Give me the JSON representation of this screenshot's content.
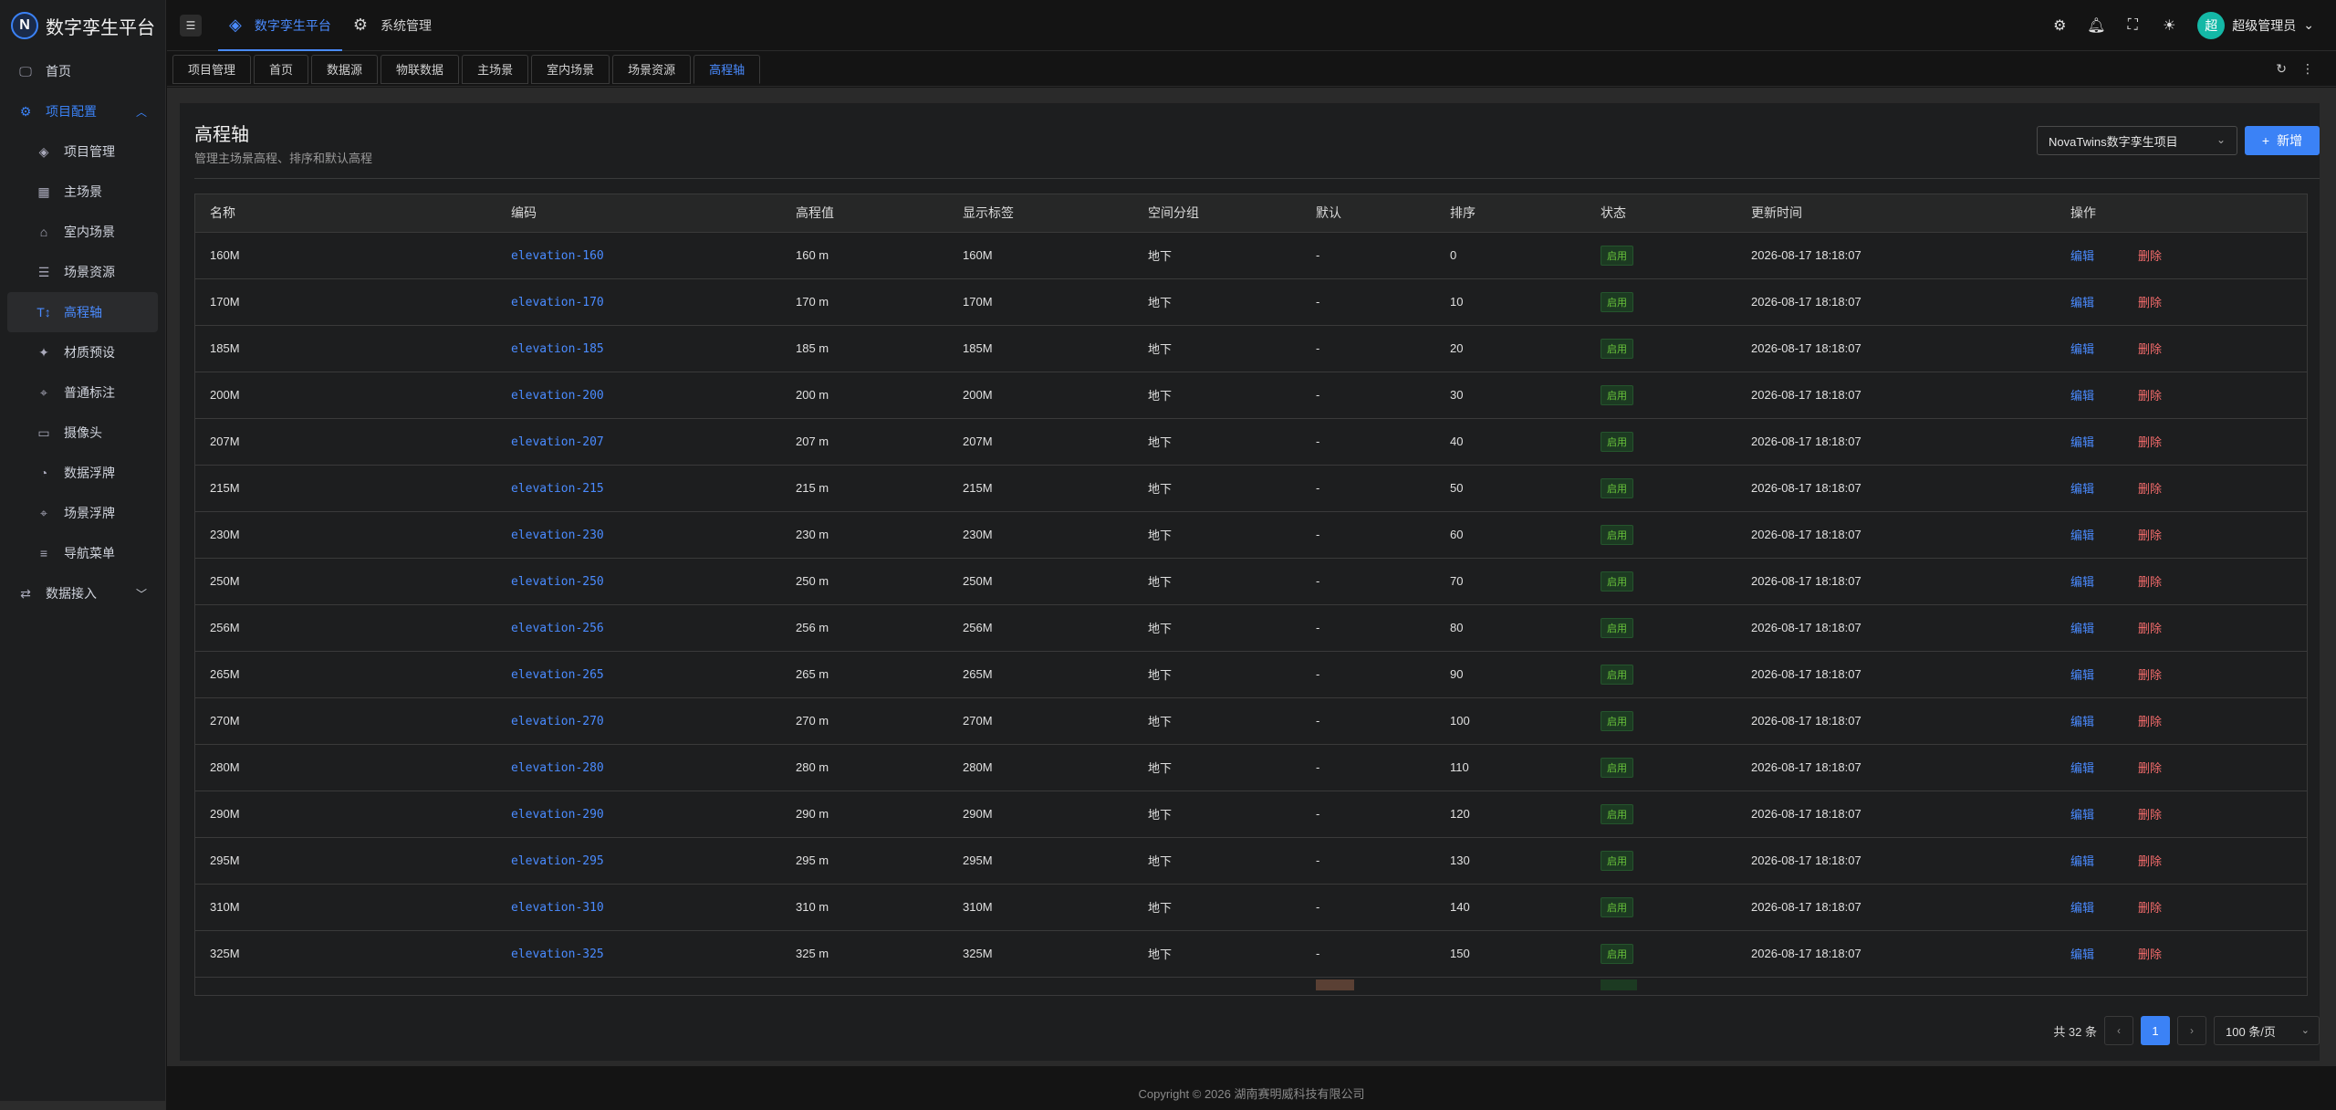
{
  "app": {
    "logo_letter": "N",
    "name": "数字孪生平台"
  },
  "sidebar": {
    "items": [
      {
        "label": "首页",
        "icon": "monitor-icon",
        "type": "top"
      },
      {
        "label": "项目配置",
        "icon": "gear-icon",
        "type": "group"
      },
      {
        "label": "项目管理",
        "icon": "layers-icon",
        "type": "sub"
      },
      {
        "label": "主场景",
        "icon": "grid-icon",
        "type": "sub"
      },
      {
        "label": "室内场景",
        "icon": "home-icon",
        "type": "sub"
      },
      {
        "label": "场景资源",
        "icon": "list-icon",
        "type": "sub"
      },
      {
        "label": "高程轴",
        "icon": "text-height-icon",
        "type": "active"
      },
      {
        "label": "材质预设",
        "icon": "palette-icon",
        "type": "sub"
      },
      {
        "label": "普通标注",
        "icon": "pin-icon",
        "type": "sub"
      },
      {
        "label": "摄像头",
        "icon": "camera-icon",
        "type": "sub"
      },
      {
        "label": "数据浮牌",
        "icon": "gauge-icon",
        "type": "sub"
      },
      {
        "label": "场景浮牌",
        "icon": "location-icon",
        "type": "sub"
      },
      {
        "label": "导航菜单",
        "icon": "menu-icon",
        "type": "sub"
      },
      {
        "label": "数据接入",
        "icon": "swap-icon",
        "type": "top-collapsed"
      }
    ]
  },
  "header": {
    "nav": [
      {
        "label": "数字孪生平台",
        "icon": "layers-icon",
        "active": true
      },
      {
        "label": "系统管理",
        "icon": "gear-icon",
        "active": false
      }
    ],
    "user_avatar": "超",
    "user_name": "超级管理员"
  },
  "tabs": [
    "项目管理",
    "首页",
    "数据源",
    "物联数据",
    "主场景",
    "室内场景",
    "场景资源",
    "高程轴"
  ],
  "active_tab": "高程轴",
  "page": {
    "title": "高程轴",
    "subtitle": "管理主场景高程、排序和默认高程",
    "project_select": "NovaTwins数字孪生项目",
    "add_button": "新增"
  },
  "table": {
    "columns": [
      "名称",
      "编码",
      "高程值",
      "显示标签",
      "空间分组",
      "默认",
      "排序",
      "状态",
      "更新时间",
      "操作"
    ],
    "rows": [
      [
        "160M",
        "elevation-160",
        "160 m",
        "160M",
        "地下",
        "-",
        "0",
        "启用",
        "2026-08-17 18:18:07"
      ],
      [
        "170M",
        "elevation-170",
        "170 m",
        "170M",
        "地下",
        "-",
        "10",
        "启用",
        "2026-08-17 18:18:07"
      ],
      [
        "185M",
        "elevation-185",
        "185 m",
        "185M",
        "地下",
        "-",
        "20",
        "启用",
        "2026-08-17 18:18:07"
      ],
      [
        "200M",
        "elevation-200",
        "200 m",
        "200M",
        "地下",
        "-",
        "30",
        "启用",
        "2026-08-17 18:18:07"
      ],
      [
        "207M",
        "elevation-207",
        "207 m",
        "207M",
        "地下",
        "-",
        "40",
        "启用",
        "2026-08-17 18:18:07"
      ],
      [
        "215M",
        "elevation-215",
        "215 m",
        "215M",
        "地下",
        "-",
        "50",
        "启用",
        "2026-08-17 18:18:07"
      ],
      [
        "230M",
        "elevation-230",
        "230 m",
        "230M",
        "地下",
        "-",
        "60",
        "启用",
        "2026-08-17 18:18:07"
      ],
      [
        "250M",
        "elevation-250",
        "250 m",
        "250M",
        "地下",
        "-",
        "70",
        "启用",
        "2026-08-17 18:18:07"
      ],
      [
        "256M",
        "elevation-256",
        "256 m",
        "256M",
        "地下",
        "-",
        "80",
        "启用",
        "2026-08-17 18:18:07"
      ],
      [
        "265M",
        "elevation-265",
        "265 m",
        "265M",
        "地下",
        "-",
        "90",
        "启用",
        "2026-08-17 18:18:07"
      ],
      [
        "270M",
        "elevation-270",
        "270 m",
        "270M",
        "地下",
        "-",
        "100",
        "启用",
        "2026-08-17 18:18:07"
      ],
      [
        "280M",
        "elevation-280",
        "280 m",
        "280M",
        "地下",
        "-",
        "110",
        "启用",
        "2026-08-17 18:18:07"
      ],
      [
        "290M",
        "elevation-290",
        "290 m",
        "290M",
        "地下",
        "-",
        "120",
        "启用",
        "2026-08-17 18:18:07"
      ],
      [
        "295M",
        "elevation-295",
        "295 m",
        "295M",
        "地下",
        "-",
        "130",
        "启用",
        "2026-08-17 18:18:07"
      ],
      [
        "310M",
        "elevation-310",
        "310 m",
        "310M",
        "地下",
        "-",
        "140",
        "启用",
        "2026-08-17 18:18:07"
      ],
      [
        "325M",
        "elevation-325",
        "325 m",
        "325M",
        "地下",
        "-",
        "150",
        "启用",
        "2026-08-17 18:18:07"
      ]
    ],
    "action_edit": "编辑",
    "action_delete": "删除"
  },
  "pagination": {
    "total_text": "共 32 条",
    "current_page": "1",
    "page_size": "100 条/页"
  },
  "footer": {
    "copyright": "Copyright © 2026 湖南赛明威科技有限公司"
  },
  "colors": {
    "accent": "#3b82f6",
    "success": "#67c23a",
    "danger": "#f56c6c",
    "bg": "#141414"
  }
}
